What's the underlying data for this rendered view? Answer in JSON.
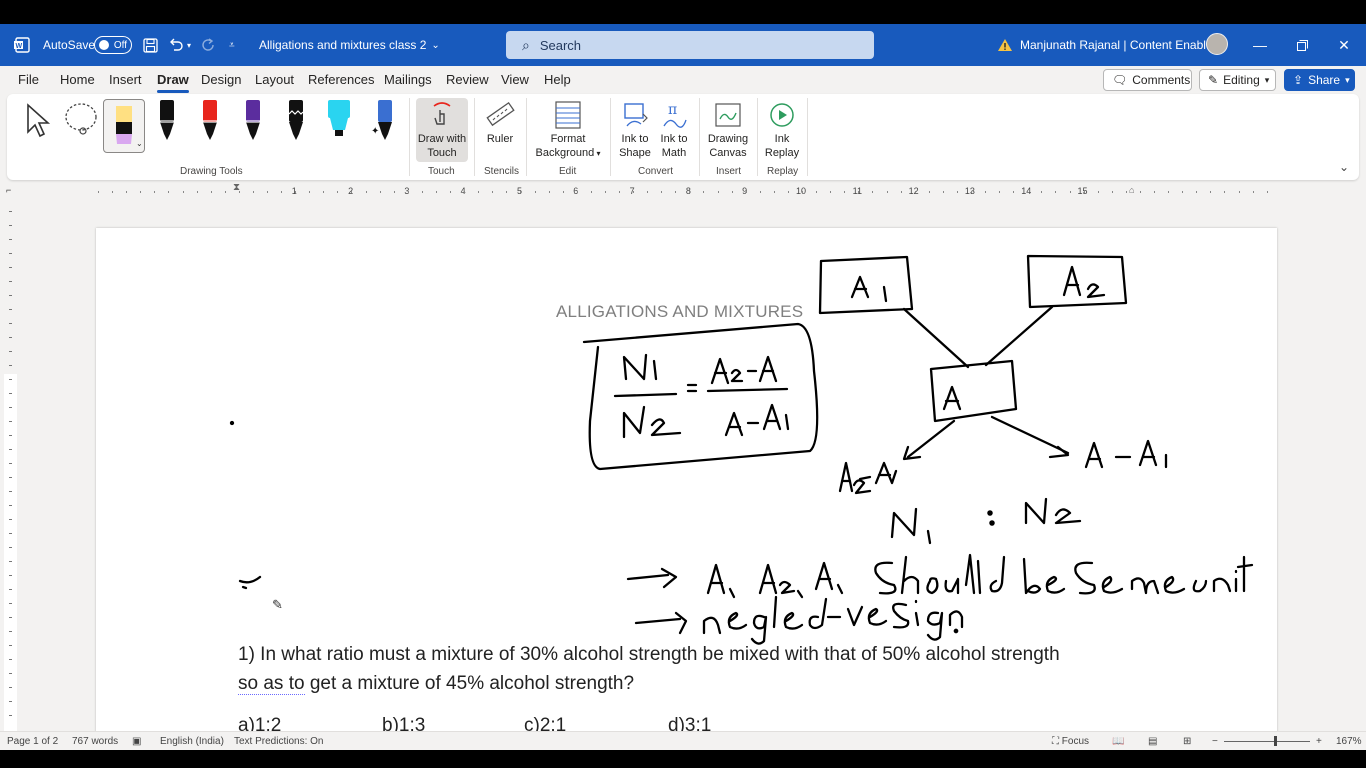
{
  "titlebar": {
    "autosave_label": "AutoSave",
    "autosave_state": "Off",
    "doc_title": "Alligations and mixtures class 2",
    "search_placeholder": "Search",
    "user_name": "Manjunath Rajanal | Content Enablers",
    "accent": "#185abd"
  },
  "menu": {
    "items": [
      "File",
      "Home",
      "Insert",
      "Draw",
      "Design",
      "Layout",
      "References",
      "Mailings",
      "Review",
      "View",
      "Help"
    ],
    "active": "Draw",
    "comments": "Comments",
    "editing": "Editing",
    "share": "Share"
  },
  "ribbon": {
    "groups": {
      "drawing_tools": "Drawing Tools",
      "touch": "Touch",
      "stencils": "Stencils",
      "edit": "Edit",
      "convert": "Convert",
      "insert": "Insert",
      "replay": "Replay"
    },
    "buttons": {
      "draw_with_touch_1": "Draw with",
      "draw_with_touch_2": "Touch",
      "ruler": "Ruler",
      "format_bg_1": "Format",
      "format_bg_2": "Background",
      "ink_to_shape_1": "Ink to",
      "ink_to_shape_2": "Shape",
      "ink_to_math_1": "Ink to",
      "ink_to_math_2": "Math",
      "drawing_canvas_1": "Drawing",
      "drawing_canvas_2": "Canvas",
      "ink_replay_1": "Ink",
      "ink_replay_2": "Replay"
    },
    "pens": [
      {
        "color": "#ffe082",
        "type": "highlighter"
      },
      {
        "color": "#111111",
        "type": "pen"
      },
      {
        "color": "#e8251c",
        "type": "pen"
      },
      {
        "color": "#5b2d9e",
        "type": "pen"
      },
      {
        "color": "#111111",
        "type": "pen"
      },
      {
        "color": "#2ad4f0",
        "type": "highlighter"
      },
      {
        "color": "#3a6fd1",
        "type": "pencil"
      }
    ]
  },
  "ruler": {
    "numbers": [
      "1",
      "2",
      "3",
      "4",
      "5",
      "6",
      "7",
      "8",
      "9",
      "10",
      "11",
      "12",
      "13",
      "14",
      "15"
    ]
  },
  "document": {
    "heading": "ALLIGATIONS AND MIXTURES",
    "question_line1": "1) In what ratio must a mixture of 30% alcohol strength be mixed with that of 50% alcohol strength",
    "question_squiggle": "so as to",
    "question_line2_rest": " get a mixture of 45% alcohol strength?",
    "options": [
      "a)1:2",
      "b)1:3",
      "c)2:1",
      "d)3:1"
    ]
  },
  "statusbar": {
    "page": "Page 1 of 2",
    "words": "767 words",
    "language": "English (India)",
    "predictions": "Text Predictions: On",
    "focus": "Focus",
    "zoom": "167%"
  }
}
